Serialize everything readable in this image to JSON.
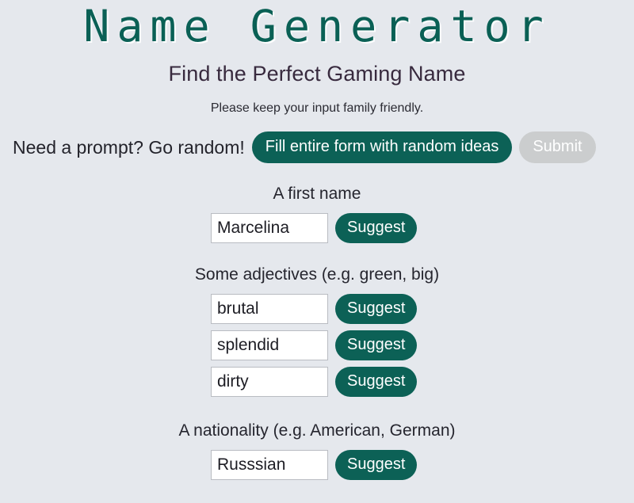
{
  "header": {
    "title": "Name Generator",
    "subtitle": "Find the Perfect Gaming Name",
    "notice": "Please keep your input family friendly."
  },
  "prompt_row": {
    "text": "Need a prompt? Go random!",
    "random_button_label": "Fill entire form with random ideas",
    "submit_button_label": "Submit"
  },
  "fields": {
    "first_name": {
      "label": "A first name",
      "value": "Marcelina",
      "suggest_label": "Suggest"
    },
    "adjectives": {
      "label": "Some adjectives (e.g. green, big)",
      "items": [
        {
          "value": "brutal",
          "suggest_label": "Suggest"
        },
        {
          "value": "splendid",
          "suggest_label": "Suggest"
        },
        {
          "value": "dirty",
          "suggest_label": "Suggest"
        }
      ]
    },
    "nationality": {
      "label": "A nationality (e.g. American, German)",
      "value": "Russsian",
      "suggest_label": "Suggest"
    }
  },
  "colors": {
    "background": "#e5e8ed",
    "accent_teal": "#0c6156",
    "title_teal": "#0a6055",
    "disabled_grey": "#cbcdce",
    "subtitle_dark": "#382a3e",
    "input_border": "#b9bcc2"
  }
}
